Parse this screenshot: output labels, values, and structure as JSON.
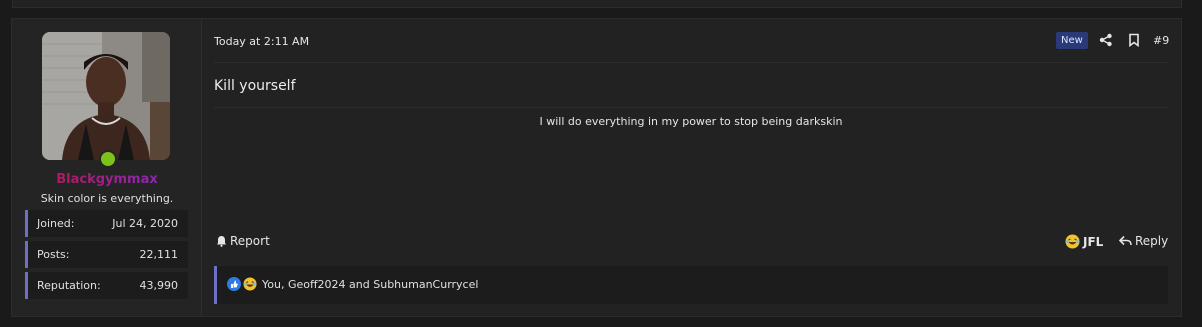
{
  "user": {
    "username": "Blackgymmax",
    "title": "Skin color is everything.",
    "stats": [
      {
        "label": "Joined:",
        "value": "Jul 24, 2020"
      },
      {
        "label": "Posts:",
        "value": "22,111"
      },
      {
        "label": "Reputation:",
        "value": "43,990"
      }
    ]
  },
  "post": {
    "timestamp": "Today at 2:11 AM",
    "badge": "New",
    "number": "#9",
    "content": "Kill yourself",
    "signature": "I will do everything in my power to stop being darkskin"
  },
  "actions": {
    "report": "Report",
    "jfl": "JFL",
    "reply": "Reply"
  },
  "reactions": {
    "text": "You, Geoff2024 and SubhumanCurrycel"
  },
  "colors": {
    "background": "#1a1a1a",
    "panel": "#222222",
    "accent": "#6f6fc6",
    "online": "#7cc21a",
    "badge": "#2a3a78"
  }
}
